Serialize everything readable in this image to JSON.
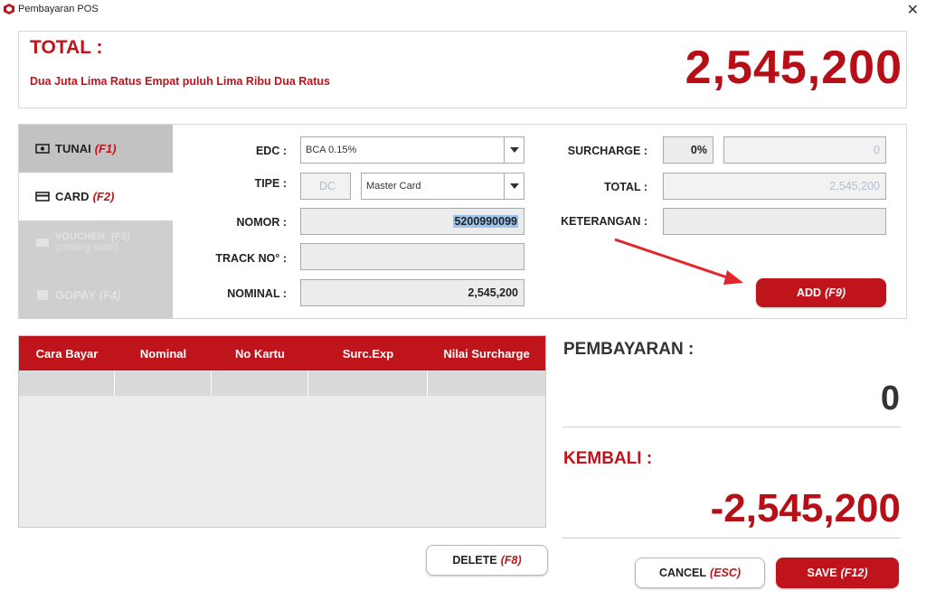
{
  "window": {
    "title": "Pembayaran POS",
    "icon": "app-logo-icon",
    "close": "✕"
  },
  "total": {
    "label": "TOTAL :",
    "words": "Dua Juta Lima Ratus Empat puluh Lima Ribu Dua Ratus",
    "amount": "2,545,200"
  },
  "methods": [
    {
      "label": "TUNAI",
      "key": "(F1)",
      "icon": "cash-icon",
      "state": "inactive"
    },
    {
      "label": "CARD",
      "key": "(F2)",
      "icon": "card-icon",
      "state": "active"
    },
    {
      "label": "VOUCHER",
      "key": "(F3)",
      "sub": "(coming soon)",
      "icon": "voucher-icon",
      "state": "disabled"
    },
    {
      "label": "GOPAY",
      "key": "(F4)",
      "icon": "gopay-icon",
      "state": "disabled"
    }
  ],
  "form": {
    "edc_label": "EDC :",
    "edc_value": "BCA 0.15%",
    "tipe_label": "TIPE :",
    "tipe_code": "DC",
    "tipe_value": "Master Card",
    "nomor_label": "NOMOR :",
    "nomor_value": "5200990099",
    "track_label": "TRACK NO° :",
    "track_value": "",
    "nominal_label": "NOMINAL :",
    "nominal_value": "2,545,200",
    "surcharge_label": "SURCHARGE :",
    "surcharge_pct": "0%",
    "surcharge_value": "0",
    "total_label": "TOTAL :",
    "total_value": "2,545,200",
    "keterangan_label": "KETERANGAN :",
    "keterangan_value": ""
  },
  "buttons": {
    "add_label": "ADD",
    "add_key": "(F9)",
    "delete_label": "DELETE",
    "delete_key": "(F8)",
    "cancel_label": "CANCEL",
    "cancel_key": "(ESC)",
    "save_label": "SAVE",
    "save_key": "(F12)"
  },
  "table": {
    "columns": [
      "Cara Bayar",
      "Nominal",
      "No Kartu",
      "Surc.Exp",
      "Nilai Surcharge"
    ]
  },
  "summary": {
    "pembayaran_label": "PEMBAYARAN :",
    "pembayaran_value": "0",
    "kembali_label": "KEMBALI :",
    "kembali_value": "-2,545,200"
  },
  "colors": {
    "accent": "#c0141c",
    "arrow": "#e3262c"
  }
}
